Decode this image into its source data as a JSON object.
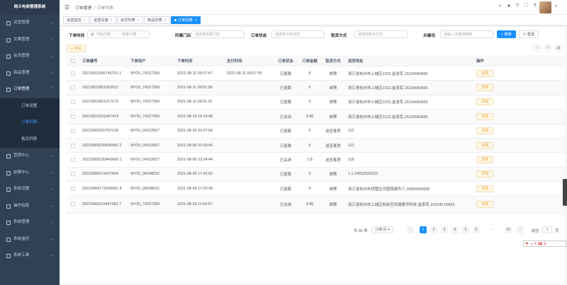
{
  "app": {
    "title": "网义电商管理系统"
  },
  "sidebar": {
    "items": [
      {
        "label": "运营管理",
        "icon": "dashboard-icon"
      },
      {
        "label": "文案管理",
        "icon": "document-icon"
      },
      {
        "label": "会员管理",
        "icon": "user-icon"
      },
      {
        "label": "商品管理",
        "icon": "goods-icon"
      },
      {
        "label": "订单管理",
        "icon": "order-icon"
      }
    ],
    "sub_items": [
      {
        "label": "订单设置"
      },
      {
        "label": "订单列表"
      },
      {
        "label": "售后列表"
      }
    ],
    "items_after": [
      {
        "label": "营销中心",
        "icon": "marketing-icon"
      },
      {
        "label": "前票中心",
        "icon": "ticket-icon"
      },
      {
        "label": "系统设置",
        "icon": "settings-icon"
      },
      {
        "label": "操作指南",
        "icon": "guide-icon"
      },
      {
        "label": "系统管理",
        "icon": "system-icon"
      },
      {
        "label": "系统监控",
        "icon": "monitor-icon"
      },
      {
        "label": "系统工具",
        "icon": "tools-icon"
      }
    ]
  },
  "header": {
    "breadcrumb": [
      "订单管理",
      "订单列表"
    ]
  },
  "tags": [
    {
      "label": "运营监控"
    },
    {
      "label": "运营设置"
    },
    {
      "label": "会员列表"
    },
    {
      "label": "商品列表"
    },
    {
      "label": "订单列表",
      "active": true
    }
  ],
  "filters": {
    "order_time_label": "下单时间",
    "start_date_placeholder": "开始日期",
    "end_date_placeholder": "结束日期",
    "store_label": "所属门店",
    "store_placeholder": "请选择所属门店",
    "status_label": "订单状态",
    "status_placeholder": "请选择订单状态",
    "pickup_label": "取货方式",
    "pickup_placeholder": "请选择取货方式",
    "keyword_label": "关键词",
    "keyword_placeholder": "请输入关键词搜索",
    "search_label": "搜索",
    "reset_label": "重置",
    "export_label": "导出"
  },
  "table": {
    "headers": [
      "订单编号",
      "下单用户",
      "下单时间",
      "支付时间",
      "订单状态",
      "订单金额",
      "取货方式",
      "送货地址",
      "操作"
    ],
    "action_label": "详情",
    "rows": [
      {
        "id": "20210811095746701 1",
        "user": "WYDI_74227358",
        "time": "2021-08-11 09:57:47",
        "pay": "2021-08-11 09:57:55",
        "status": "已退款",
        "amount": "8",
        "method": "邮寄",
        "addr": "浙江省杭州市上城区2222,金张军,15224060665"
      },
      {
        "id": "20210810951583012",
        "user": "WYDI_74227358",
        "time": "2021-08-11 09:51:58",
        "pay": "",
        "status": "已退款",
        "amount": "0",
        "method": "邮寄",
        "addr": "浙江省杭州市上城区2222,金张军,15224060665"
      },
      {
        "id": "20210810951317173",
        "user": "WYDI_74227358",
        "time": "2021-08-11 09:51:31",
        "pay": "",
        "status": "已退款",
        "amount": "0",
        "method": "邮寄",
        "addr": "浙江省杭州市上城区2222,金张军,15224060665"
      },
      {
        "id": "20210810161447474",
        "user": "WYDI_74227358",
        "time": "2021-08-10 16:14:48",
        "pay": "",
        "status": "已关闭",
        "amount": "9.96",
        "method": "邮寄",
        "addr": "浙江省杭州市上城区2222,金张军,15224060665"
      },
      {
        "id": "20210809220757128",
        "user": "WYDI_04152657",
        "time": "2021-08-09 22:07:58",
        "pay": "",
        "status": "已退款",
        "amount": "0",
        "method": "送至客房",
        "addr": "112"
      },
      {
        "id": "20210809220540582 2",
        "user": "WYDI_04152657",
        "time": "2021-08-09 22:05:40",
        "pay": "",
        "status": "已退款",
        "amount": "0",
        "method": "送至客房",
        "addr": "112"
      },
      {
        "id": "20210809220443669 1",
        "user": "WYDI_04152657",
        "time": "2021-08-09 22:04:44",
        "pay": "",
        "status": "已关闭",
        "amount": "2.8",
        "method": "送至客房",
        "addr": "118"
      },
      {
        "id": "20210809174207664",
        "user": "WYDI_30548532",
        "time": "2021-08-09 17:42:02",
        "pay": "",
        "status": "已退款",
        "amount": "0",
        "method": "邮寄",
        "addr": "1,1,14552526323"
      },
      {
        "id": "20210809172049451 8",
        "user": "WYDI_30548532",
        "time": "2021-08-09 17:20:49",
        "pay": "",
        "status": "已退款",
        "amount": "0",
        "method": "邮寄",
        "addr": "浙江省杭州市拱墅区中国铁建东三,16666669696"
      },
      {
        "id": "20210809115457062 7",
        "user": "WYDI_74227358",
        "time": "2021-08-09 11:54:57",
        "pay": "",
        "status": "已关闭",
        "amount": "9.96",
        "method": "邮寄",
        "addr": "浙江省杭州市上城区网余空间湖墨坪科技,金张军,152240 60665"
      }
    ]
  },
  "pagination": {
    "total": "共 82 条",
    "page_size": "10条/页",
    "pages": [
      "1",
      "2",
      "3",
      "4",
      "5",
      "6",
      "10"
    ],
    "ellipsis": "···",
    "current": "1",
    "goto_label": "前往",
    "goto_value": "1",
    "page_unit": "页"
  },
  "colors": {
    "sidebar_bg": "#304156",
    "primary": "#1890ff",
    "warning": "#e6a23c"
  }
}
